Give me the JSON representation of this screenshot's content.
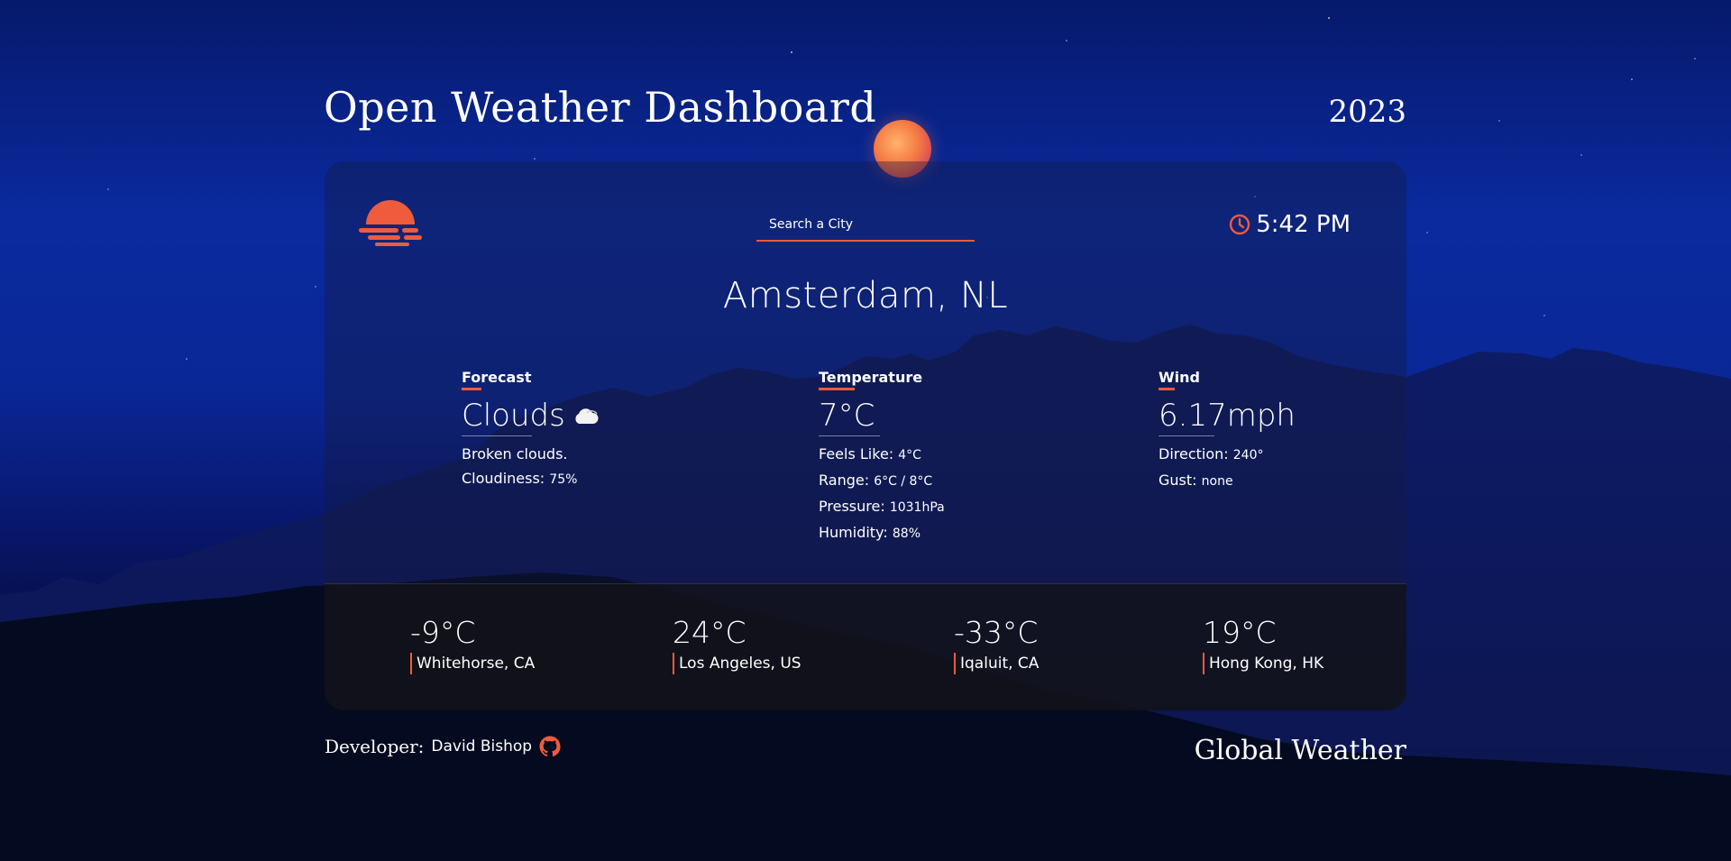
{
  "header": {
    "title": "Open Weather Dashboard",
    "year": "2023"
  },
  "search": {
    "placeholder": "Search a City"
  },
  "clock": {
    "time": "5:42 PM"
  },
  "city": {
    "name": "Amsterdam, NL"
  },
  "forecast": {
    "label": "Forecast",
    "main": "Clouds",
    "icon": "cloud-icon",
    "description": "Broken clouds.",
    "cloudiness_label": "Cloudiness:",
    "cloudiness_value": "75%"
  },
  "temperature": {
    "label": "Temperature",
    "main": "7°C",
    "feels_like_label": "Feels Like:",
    "feels_like_value": "4°C",
    "range_label": "Range:",
    "range_value": "6°C / 8°C",
    "pressure_label": "Pressure:",
    "pressure_value": "1031hPa",
    "humidity_label": "Humidity:",
    "humidity_value": "88%"
  },
  "wind": {
    "label": "Wind",
    "main": "6.17mph",
    "direction_label": "Direction:",
    "direction_value": "240°",
    "gust_label": "Gust:",
    "gust_value": "none"
  },
  "global_cities": [
    {
      "temp": "-9°C",
      "name": "Whitehorse, CA"
    },
    {
      "temp": "24°C",
      "name": "Los Angeles, US"
    },
    {
      "temp": "-33°C",
      "name": "Iqaluit, CA"
    },
    {
      "temp": "19°C",
      "name": "Hong Kong, HK"
    }
  ],
  "footer": {
    "developer_label": "Developer:",
    "developer_name": "David Bishop",
    "github_icon": "github-icon",
    "right_title": "Global Weather"
  },
  "colors": {
    "accent": "#ef5b3d",
    "background": "#0a2796"
  }
}
